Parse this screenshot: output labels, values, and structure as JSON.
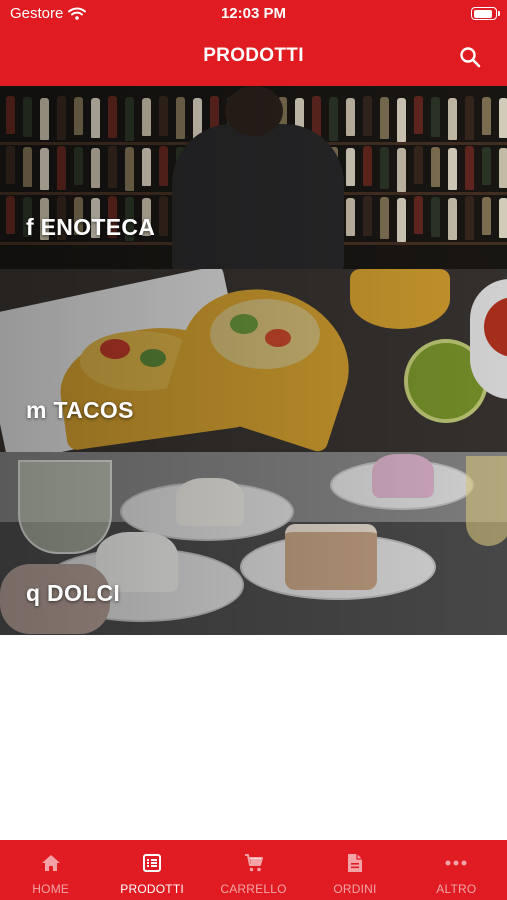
{
  "status_bar": {
    "carrier": "Gestore",
    "time": "12:03 PM",
    "battery_level": 0.9
  },
  "header": {
    "title": "PRODOTTI",
    "search_icon": "search-icon"
  },
  "categories": [
    {
      "label": "f ENOTECA"
    },
    {
      "label": "m TACOS"
    },
    {
      "label": "q DOLCI"
    }
  ],
  "tabbar": {
    "active": "PRODOTTI",
    "items": [
      {
        "label": "HOME",
        "icon": "home-icon"
      },
      {
        "label": "PRODOTTI",
        "icon": "list-icon"
      },
      {
        "label": "CARRELLO",
        "icon": "cart-icon"
      },
      {
        "label": "ORDINI",
        "icon": "document-icon"
      },
      {
        "label": "ALTRO",
        "icon": "more-icon"
      }
    ]
  },
  "colors": {
    "brand_red": "#e01b22",
    "white": "#ffffff"
  }
}
